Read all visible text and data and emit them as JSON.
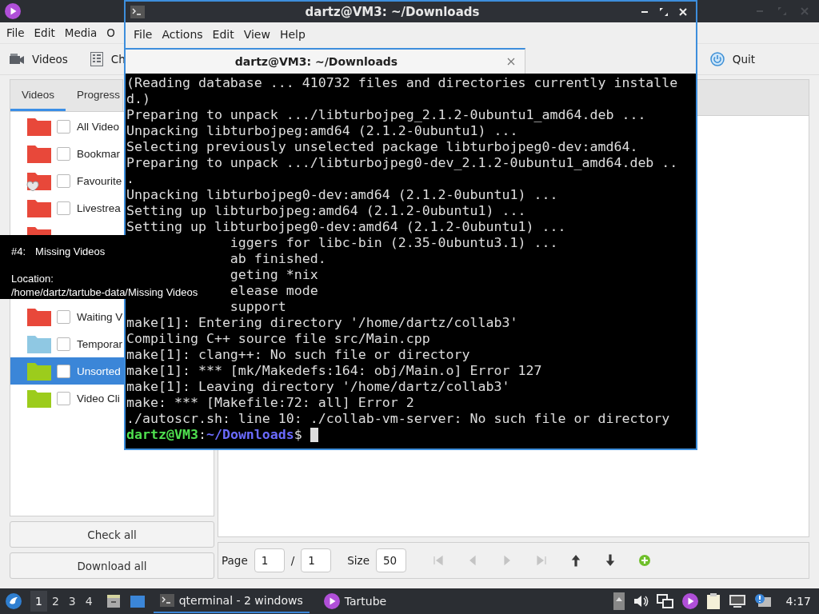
{
  "tartube": {
    "menu": [
      "File",
      "Edit",
      "Media",
      "O"
    ],
    "toolbar": [
      {
        "label": "Videos",
        "kind": "videos"
      },
      {
        "label": "Ch",
        "kind": "channels"
      }
    ],
    "quit": "Quit",
    "tabs": [
      {
        "label": "Videos",
        "selected": true
      },
      {
        "label": "Progress",
        "selected": false
      }
    ],
    "folders": [
      {
        "label": "All Video",
        "color": "#e8483a",
        "checked": false,
        "selected": false,
        "favourite": false
      },
      {
        "label": "Bookmar",
        "color": "#e8483a",
        "checked": false,
        "selected": false,
        "favourite": false
      },
      {
        "label": "Favourite",
        "color": "#e8483a",
        "checked": false,
        "selected": false,
        "favourite": true
      },
      {
        "label": "Livestrea",
        "color": "#e8483a",
        "checked": false,
        "selected": false,
        "favourite": false
      },
      {
        "color": "#e8483a"
      },
      {
        "label": "Waiting V",
        "color": "#e8483a",
        "checked": false,
        "selected": false,
        "favourite": false
      },
      {
        "label": "Temporar",
        "color": "#8fc8e3",
        "checked": false,
        "selected": false,
        "favourite": false
      },
      {
        "label": "Unsorted",
        "color": "#9ccc1c",
        "checked": false,
        "selected": true,
        "favourite": false
      },
      {
        "label": "Video Cli",
        "color": "#9ccc1c",
        "checked": false,
        "selected": false,
        "favourite": false
      }
    ],
    "buttons": [
      "Check all",
      "Download all"
    ],
    "pager": {
      "page_label": "Page",
      "page": "1",
      "separator": "/",
      "pages": "1",
      "size_label": "Size",
      "size": "50",
      "nav": [
        {
          "kind": "first",
          "disabled": true
        },
        {
          "kind": "previous",
          "disabled": true
        },
        {
          "kind": "next",
          "disabled": true
        },
        {
          "kind": "last",
          "disabled": true
        },
        {
          "kind": "up",
          "disabled": false
        },
        {
          "kind": "down",
          "disabled": false
        },
        {
          "kind": "add",
          "disabled": false
        }
      ]
    }
  },
  "terminal": {
    "title": "dartz@VM3: ~/Downloads",
    "menu": [
      "File",
      "Actions",
      "Edit",
      "View",
      "Help"
    ],
    "tab": "dartz@VM3: ~/Downloads",
    "lines": [
      {
        "text": "(Reading database ... 410732 files and directories currently installe",
        "covered": false
      },
      {
        "text": "d.)",
        "covered": false
      },
      {
        "text": "Preparing to unpack .../libturbojpeg_2.1.2-0ubuntu1_amd64.deb ...",
        "covered": false
      },
      {
        "text": "Unpacking libturbojpeg:amd64 (2.1.2-0ubuntu1) ...",
        "covered": false
      },
      {
        "text": "Selecting previously unselected package libturbojpeg0-dev:amd64.",
        "covered": false
      },
      {
        "text": "Preparing to unpack .../libturbojpeg0-dev_2.1.2-0ubuntu1_amd64.deb ..",
        "covered": false
      },
      {
        "text": ".",
        "covered": false
      },
      {
        "text": "Unpacking libturbojpeg0-dev:amd64 (2.1.2-0ubuntu1) ...",
        "covered": false
      },
      {
        "text": "Setting up libturbojpeg:amd64 (2.1.2-0ubuntu1) ...",
        "covered": false
      },
      {
        "text": "Setting up libturbojpeg0-dev:amd64 (2.1.2-0ubuntu1) ...",
        "covered": false
      },
      {
        "text": "iggers for libc-bin (2.35-0ubuntu3.1) ...",
        "covered": true
      },
      {
        "text": "ab finished.",
        "covered": true
      },
      {
        "text": "geting *nix",
        "covered": true
      },
      {
        "text": "elease mode",
        "covered": true
      },
      {
        "text": "support",
        "covered": true
      },
      {
        "text": "make[1]: Entering directory '/home/dartz/collab3'",
        "covered": false
      },
      {
        "text": "Compiling C++ source file src/Main.cpp",
        "covered": false
      },
      {
        "text": "make[1]: clang++: No such file or directory",
        "covered": false
      },
      {
        "text": "make[1]: *** [mk/Makedefs:164: obj/Main.o] Error 127",
        "covered": false
      },
      {
        "text": "make[1]: Leaving directory '/home/dartz/collab3'",
        "covered": false
      },
      {
        "text": "make: *** [Makefile:72: all] Error 2",
        "covered": false
      },
      {
        "text": "./autoscr.sh: line 10: ./collab-vm-server: No such file or directory",
        "covered": false
      }
    ],
    "prompt": {
      "user": "dartz@VM3",
      "separator": ":",
      "path": "~/Downloads",
      "sign": "$"
    }
  },
  "tooltip": {
    "number": "#4:",
    "name": "Missing Videos",
    "location_label": "Location:",
    "path": "/home/dartz/tartube-data/Missing Videos"
  },
  "taskbar": {
    "desktops": [
      {
        "label": "1",
        "selected": true
      },
      {
        "label": "2",
        "selected": false
      },
      {
        "label": "3",
        "selected": false
      },
      {
        "label": "4",
        "selected": false
      }
    ],
    "tasks": [
      {
        "label": "qterminal - 2 windows",
        "kind": "terminal",
        "selected": true
      },
      {
        "label": "Tartube",
        "kind": "tartube",
        "selected": false
      }
    ],
    "clock": "4:17"
  }
}
